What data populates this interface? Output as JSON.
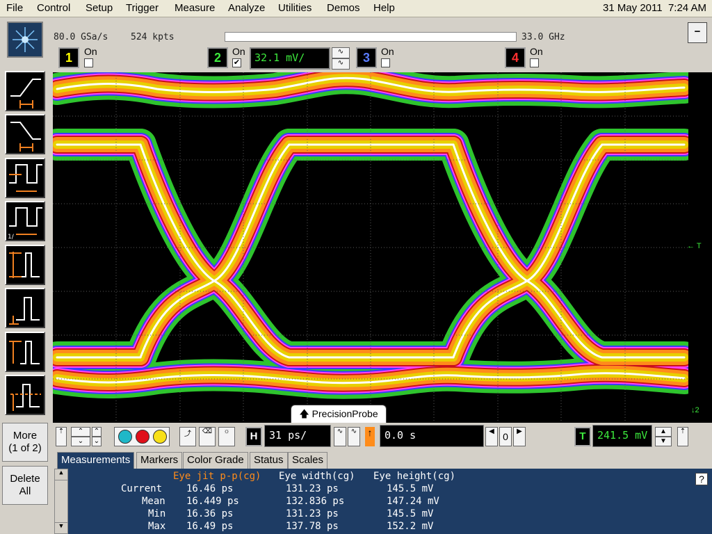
{
  "menu": [
    "File",
    "Control",
    "Setup",
    "Trigger",
    "Measure",
    "Analyze",
    "Utilities",
    "Demos",
    "Help"
  ],
  "datetime": {
    "date": "31 May 2011",
    "time": "7:24 AM"
  },
  "acquisition": {
    "sample_rate": "80.0 GSa/s",
    "memory": "524 kpts",
    "bandwidth": "33.0 GHz"
  },
  "channels": [
    {
      "num": "1",
      "on_label": "On",
      "checked": "",
      "color": "#ffff00"
    },
    {
      "num": "2",
      "on_label": "On",
      "checked": "✔",
      "color": "#3dea3d",
      "scale": "32.1 mV/"
    },
    {
      "num": "3",
      "on_label": "On",
      "checked": "",
      "color": "#5a7cff"
    },
    {
      "num": "4",
      "on_label": "On",
      "checked": "",
      "color": "#ff3030"
    }
  ],
  "left_panel": {
    "more_label": "More",
    "more_page": "(1 of 2)",
    "delete_label": "Delete",
    "delete_label2": "All"
  },
  "precision_probe": "PrecisionProbe",
  "horizontal": {
    "h_label": "H",
    "timebase": "31 ps/",
    "delay": "0.0 s",
    "ref": "0"
  },
  "trigger": {
    "t_label": "T",
    "level": "241.5 mV"
  },
  "tabs": [
    "Measurements",
    "Markers",
    "Color Grade",
    "Status",
    "Scales"
  ],
  "measurements": {
    "headers": [
      "Eye jit p-p(cg)",
      "Eye width(cg)",
      "Eye height(cg)"
    ],
    "rows": [
      {
        "label": "Current",
        "values": [
          "16.46 ps",
          "131.23 ps",
          "145.5 mV"
        ]
      },
      {
        "label": "Mean",
        "values": [
          "16.449 ps",
          "132.836 ps",
          "147.24 mV"
        ]
      },
      {
        "label": "Min",
        "values": [
          "16.36 ps",
          "131.23 ps",
          "145.5 mV"
        ]
      },
      {
        "label": "Max",
        "values": [
          "16.49 ps",
          "137.78 ps",
          "152.2 mV"
        ]
      }
    ]
  },
  "colors": {
    "screen_bg": "#000000",
    "menu_bg": "#ece9d8",
    "panel_bg": "#1e3c64",
    "trace": "#3dea3d",
    "highlight": "#ff8c1a"
  }
}
